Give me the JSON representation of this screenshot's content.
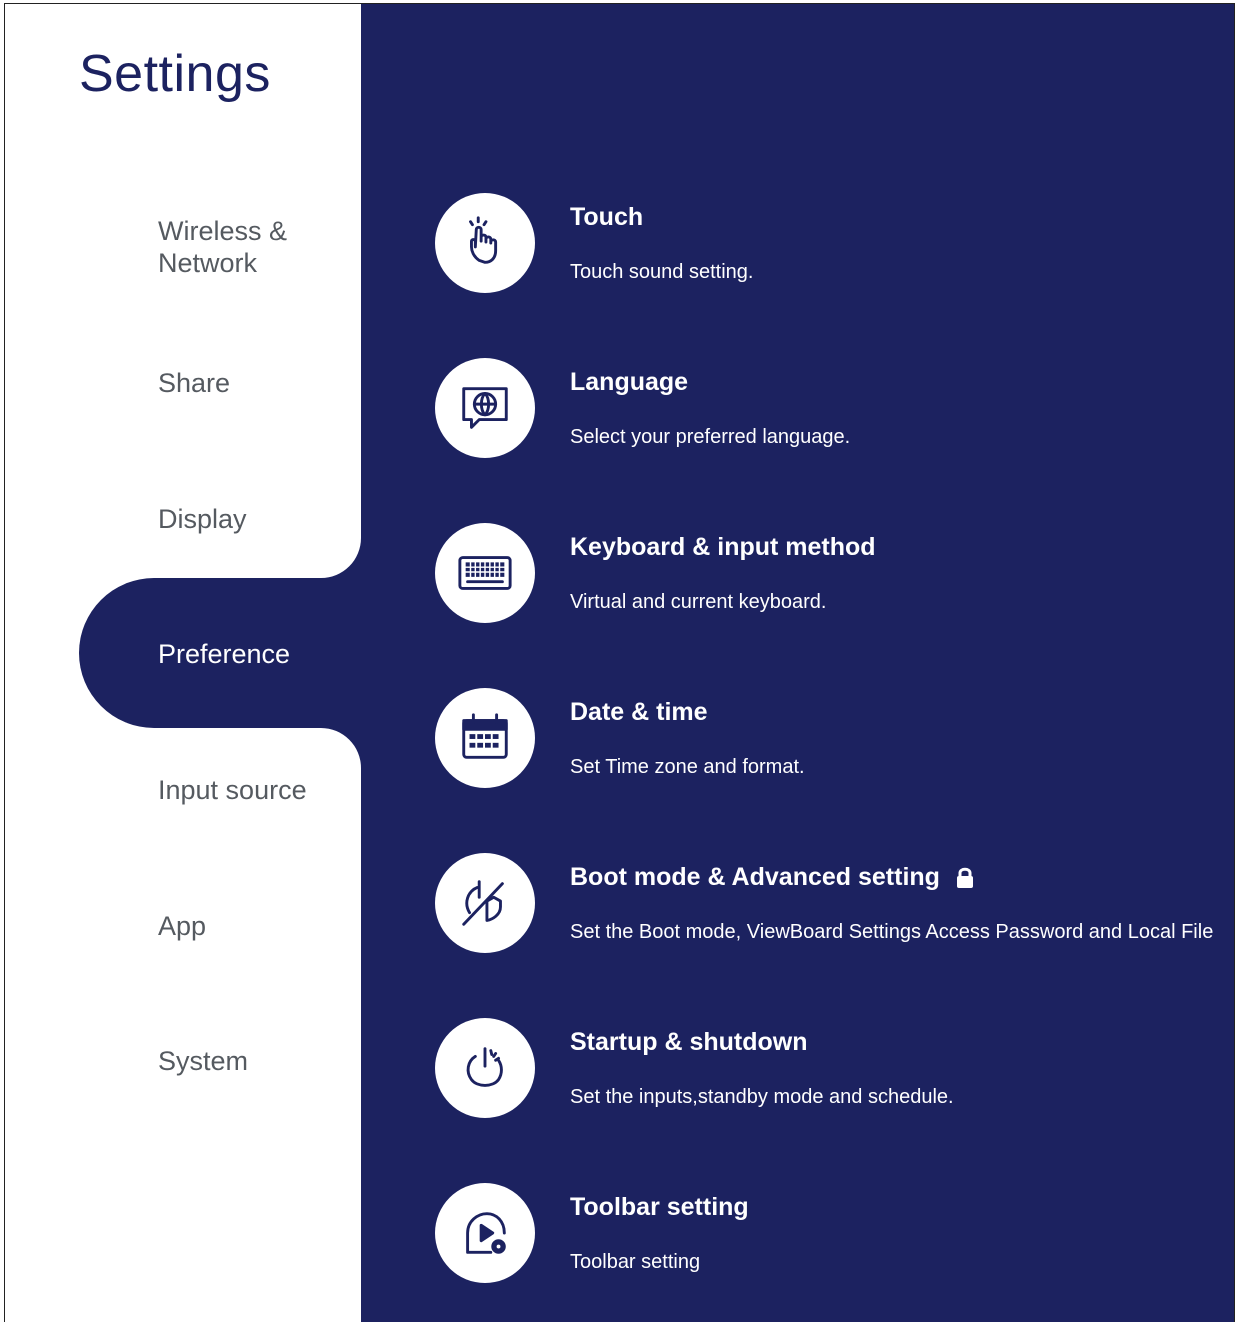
{
  "sidebar": {
    "title": "Settings",
    "items": [
      {
        "label": "Wireless &\nNetwork",
        "active": false
      },
      {
        "label": "Share",
        "active": false
      },
      {
        "label": "Display",
        "active": false
      },
      {
        "label": "Preference",
        "active": true
      },
      {
        "label": "Input source",
        "active": false
      },
      {
        "label": "App",
        "active": false
      },
      {
        "label": "System",
        "active": false
      }
    ]
  },
  "settings": [
    {
      "title": "Touch",
      "description": "Touch sound setting.",
      "icon": "touch-hand-icon"
    },
    {
      "title": "Language",
      "description": "Select your preferred language.",
      "icon": "globe-chat-icon"
    },
    {
      "title": "Keyboard & input method",
      "description": "Virtual and current keyboard.",
      "icon": "keyboard-icon"
    },
    {
      "title": "Date & time",
      "description": "Set Time zone and format.",
      "icon": "calendar-icon"
    },
    {
      "title": "Boot mode & Advanced setting",
      "description": "Set the Boot mode, ViewBoard Settings Access Password and Local File",
      "icon": "boot-shield-icon",
      "locked": true
    },
    {
      "title": "Startup & shutdown",
      "description": "Set the inputs,standby mode and schedule.",
      "icon": "power-icon"
    },
    {
      "title": "Toolbar setting",
      "description": "Toolbar setting",
      "icon": "toolbar-play-gear-icon"
    }
  ],
  "colors": {
    "accent": "#1c2260",
    "nav_text": "#555a60",
    "background": "#ffffff"
  }
}
